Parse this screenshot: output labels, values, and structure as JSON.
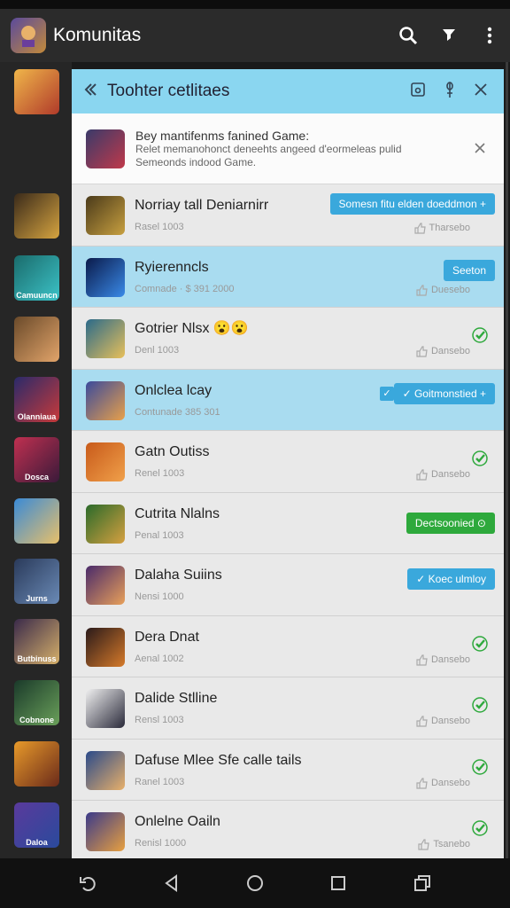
{
  "app_bar": {
    "title": "Komunitas"
  },
  "panel": {
    "title": "Toohter cetlitaes",
    "notice": {
      "title": "Bey mantifenms fanined Game:",
      "lines": [
        "Relet memanohonct deneehts angeed d'eormeleas pulid",
        "Semeonds indood Game."
      ]
    }
  },
  "rows": [
    {
      "name": "Norriay tall Deniarnirr",
      "meta": "Rasel 1003",
      "tag": "Tharsebo",
      "chip": "Somesn fitu elden doeddmon +",
      "chip_color": "blue"
    },
    {
      "name": "Ryierenncls",
      "meta": "Comnade · $ 391 2000",
      "tag": "Duesebo",
      "chip": "Seeton",
      "chip_color": "blue",
      "highlight": true
    },
    {
      "name": "Gotrier Nlsx 😮😮",
      "meta": "Denl 1003",
      "tag": "Dansebo",
      "check": true
    },
    {
      "name": "Onlclea lcay",
      "meta": "Contunade 385 301",
      "tag": "",
      "chip": "✓ Goitmonstied +",
      "chip_color": "blue",
      "highlight": true,
      "checkbox": true
    },
    {
      "name": "Gatn Outiss",
      "meta": "Renel 1003",
      "tag": "Dansebo",
      "check": true
    },
    {
      "name": "Cutrita Nlalns",
      "meta": "Penal 1003",
      "tag": "",
      "chip": "Dectsoonied ⊙",
      "chip_color": "green"
    },
    {
      "name": "Dalaha Suiins",
      "meta": "Nensi 1000",
      "tag": "",
      "chip": "✓ Koec ulmloy",
      "chip_color": "blue"
    },
    {
      "name": "Dera Dnat",
      "meta": "Aenal 1002",
      "tag": "Dansebo",
      "check": true
    },
    {
      "name": "Dalide Stlline",
      "meta": "Rensl 1003",
      "tag": "Dansebo",
      "check": true
    },
    {
      "name": "Dafuse Mlee Sfe calle tails",
      "meta": "Ranel 1003",
      "tag": "Dansebo",
      "check": true
    },
    {
      "name": "Onlelne Oailn",
      "meta": "Renisl 1000",
      "tag": "Tsanebo",
      "check": true
    }
  ],
  "rail_labels": [
    "",
    "",
    "",
    "Camuuncn",
    "",
    "Olanniaua",
    "Dosca",
    "",
    "Jurns",
    "Butbinuss",
    "Cobnone",
    "",
    "Daloa"
  ],
  "icons": {
    "search": "search-icon",
    "filter": "filter-icon",
    "more": "more-vert-icon",
    "back": "back-icon",
    "pin": "pin-icon",
    "close": "close-icon",
    "check": "check-icon",
    "like": "thumb-icon"
  },
  "colors": {
    "accent": "#3aa8dc",
    "highlight": "#a9dcf0",
    "green": "#2ea93c",
    "header": "#8ad6f0"
  }
}
